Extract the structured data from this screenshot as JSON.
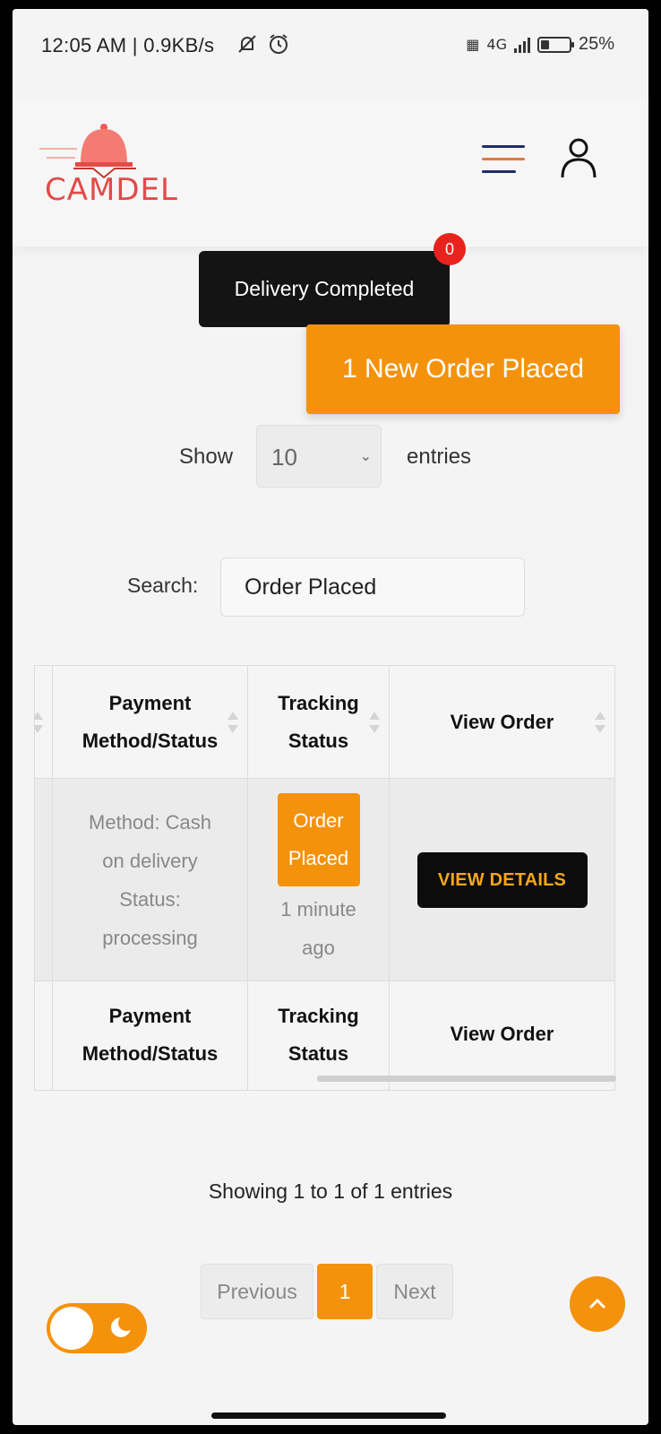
{
  "status_bar": {
    "time": "12:05 AM | 0.9KB/s",
    "notif_icons": "silent-alarm-icons",
    "network_label": "4G",
    "battery_percent": "25%",
    "battery_level": 0.25
  },
  "header": {
    "logo_text": "CAMDEL",
    "menu_icon": "hamburger-icon",
    "user_icon": "user-icon"
  },
  "toasts": {
    "delivery_label": "Delivery Completed",
    "delivery_badge": "0",
    "new_order_label": "1 New Order Placed"
  },
  "controls": {
    "show_label": "Show",
    "entries_value": "10",
    "entries_label": "entries",
    "search_label": "Search:",
    "search_value": "Order Placed"
  },
  "table": {
    "columns": [
      "Payment Method/Status",
      "Tracking Status",
      "View Order"
    ],
    "row": {
      "payment_method": "Method: Cash on delivery",
      "payment_status": "Status: processing",
      "tracking_status": "Order Placed",
      "tracking_time": "1 minute ago",
      "view_button": "VIEW DETAILS"
    }
  },
  "footer": {
    "info": "Showing 1 to 1 of 1 entries",
    "prev_label": "Previous",
    "current_page": "1",
    "next_label": "Next"
  },
  "colors": {
    "accent": "#f4920c",
    "dark": "#141414",
    "badge": "#e8231e"
  }
}
